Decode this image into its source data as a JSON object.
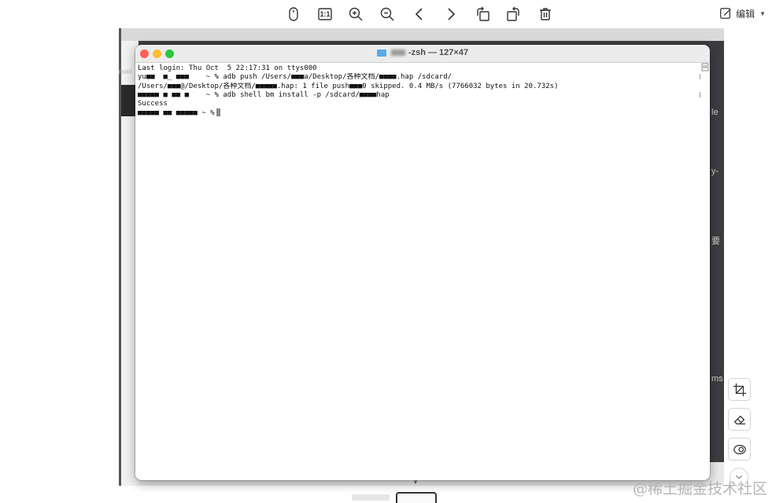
{
  "toolbar": {
    "buttons": [
      {
        "name": "mouse-icon"
      },
      {
        "name": "actual-size-icon",
        "label": "1:1"
      },
      {
        "name": "zoom-in-icon"
      },
      {
        "name": "zoom-out-icon"
      },
      {
        "name": "previous-icon"
      },
      {
        "name": "next-icon"
      },
      {
        "name": "rotate-left-icon"
      },
      {
        "name": "rotate-right-icon"
      },
      {
        "name": "delete-icon"
      }
    ],
    "edit_label": "编辑"
  },
  "background_fragments": {
    "mail": "mail",
    "le": "le",
    "ty": "y-",
    "yao": "要",
    "ms": "ms"
  },
  "terminal": {
    "title": "-zsh — 127×47",
    "lines": [
      "Last login: Thu Oct  5 22:17:31 on ttys000",
      "yu■■  ■_ ■■■    ~ % adb push /Users/■■■a/Desktop/各种文档/■■■■.hap /sdcard/",
      "/Users/■■■@/Desktop/各种文档/■■■■■.hap: 1 file push■■■0 skipped. 0.4 MB/s (7766032 bytes in 20.732s)",
      "■■■■■ ■ ■■ ■    ~ % adb shell bm install -p /sdcard/■■■■hap",
      "Success",
      "■■■■■ ■■ ■■■■■ ~ %"
    ]
  },
  "side_tools": [
    {
      "name": "crop-icon"
    },
    {
      "name": "eraser-icon"
    },
    {
      "name": "mosaic-icon"
    },
    {
      "name": "chevron-down-icon"
    }
  ],
  "watermark": "@稀土掘金技术社区"
}
